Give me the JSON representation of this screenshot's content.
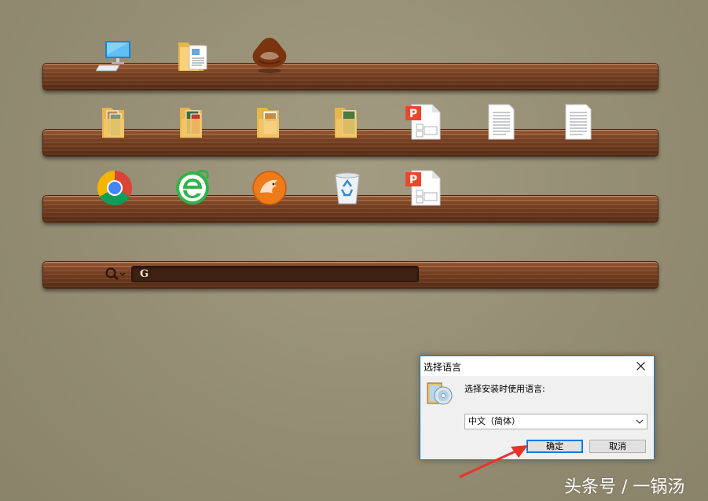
{
  "desktop": {
    "shelves": [
      {
        "row": 1,
        "icons": [
          "computer-icon",
          "documents-folder-icon",
          "chestnut-app-icon"
        ]
      },
      {
        "row": 2,
        "icons": [
          "photo-folder-icon",
          "photo-folder-icon",
          "folder-icon",
          "folder-icon",
          "presentation-file-icon",
          "text-file-icon",
          "text-file-icon"
        ]
      },
      {
        "row": 3,
        "icons": [
          "chrome-browser-icon",
          "ie-browser-icon",
          "cheetah-browser-icon",
          "recycle-bin-icon",
          "presentation-file-icon"
        ]
      }
    ],
    "search": {
      "logo_text": "G",
      "icon": "search-icon"
    }
  },
  "dialog": {
    "title": "选择语言",
    "prompt": "选择安装时使用语言:",
    "selected_language": "中文（简体）",
    "ok_label": "确定",
    "cancel_label": "取消",
    "icon": "installer-cd-icon"
  },
  "annotation": {
    "arrow_color": "#e8322a"
  },
  "watermark": "头条号 / 一锅汤"
}
